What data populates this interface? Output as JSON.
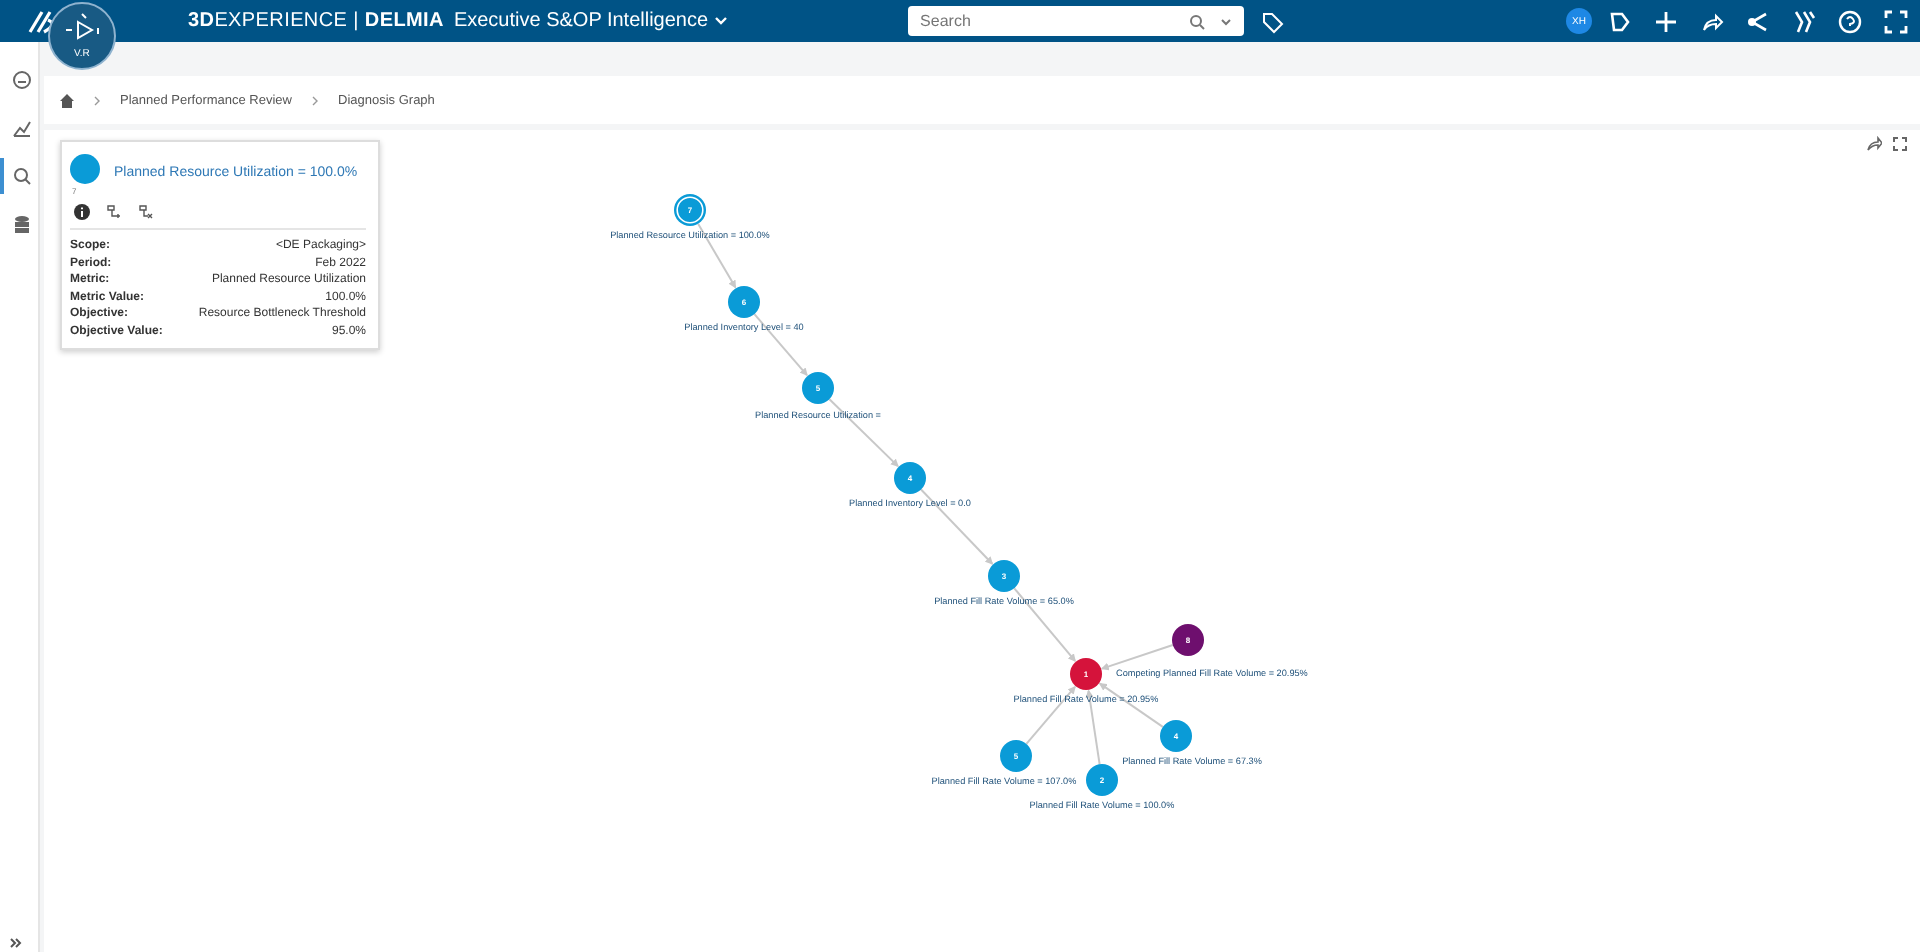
{
  "topbar": {
    "brand": "**3D**EXPERIENCE | **DELMIA**",
    "app": "Executive S&OP Intelligence",
    "search": {
      "placeholder": "Search"
    },
    "avatar": "XH"
  },
  "compass": {
    "label": "V.R"
  },
  "sidebar": {
    "items": [
      {
        "selected": false
      },
      {
        "selected": false
      },
      {
        "selected": true
      },
      {
        "selected": false
      }
    ]
  },
  "breadcrumb": [
    "Planned Performance Review",
    "Diagnosis Graph"
  ],
  "card": {
    "title": "Planned Resource Utilization = 100.0%",
    "index": "7",
    "color": "#0a9bd7",
    "fields": [
      {
        "label": "Scope:",
        "value": "<DE Packaging>"
      },
      {
        "label": "Period:",
        "value": "Feb 2022"
      },
      {
        "label": "Metric:",
        "value": "Planned Resource Utilization"
      },
      {
        "label": "Metric Value:",
        "value": "100.0%"
      },
      {
        "label": "Objective:",
        "value": "Resource Bottleneck Threshold"
      },
      {
        "label": "Objective Value:",
        "value": "95.0%"
      }
    ]
  },
  "graph": {
    "nodes": [
      {
        "number": "7",
        "label": "Planned Resource Utilization = 100.0%",
        "color": "#0a9bd7",
        "kind": "root"
      },
      {
        "number": "6",
        "label": "Planned Inventory Level = 40",
        "color": "#0a9bd7",
        "kind": "node"
      },
      {
        "number": "5",
        "label": "Planned Resource Utilization =",
        "color": "#0a9bd7",
        "kind": "node"
      },
      {
        "number": "4",
        "label": "Planned Inventory Level = 0.0",
        "color": "#0a9bd7",
        "kind": "node"
      },
      {
        "number": "3",
        "label": "Planned Fill Rate Volume = 65.0%",
        "color": "#0a9bd7",
        "kind": "node"
      },
      {
        "number": "1",
        "label": "Planned Fill Rate Volume = 20.95%",
        "color": "#d5133b",
        "kind": "node"
      },
      {
        "number": "8",
        "label": "Competing Planned Fill Rate Volume = 20.95%",
        "color": "#6e0f6e",
        "kind": "node"
      },
      {
        "number": "4",
        "label": "Planned Fill Rate Volume = 67.3%",
        "color": "#0a9bd7",
        "kind": "node"
      },
      {
        "number": "5",
        "label": "Planned Fill Rate Volume = 107.0%",
        "color": "#0a9bd7",
        "kind": "node"
      },
      {
        "number": "2",
        "label": "Planned Fill Rate Volume = 100.0%",
        "color": "#0a9bd7",
        "kind": "node"
      }
    ]
  }
}
